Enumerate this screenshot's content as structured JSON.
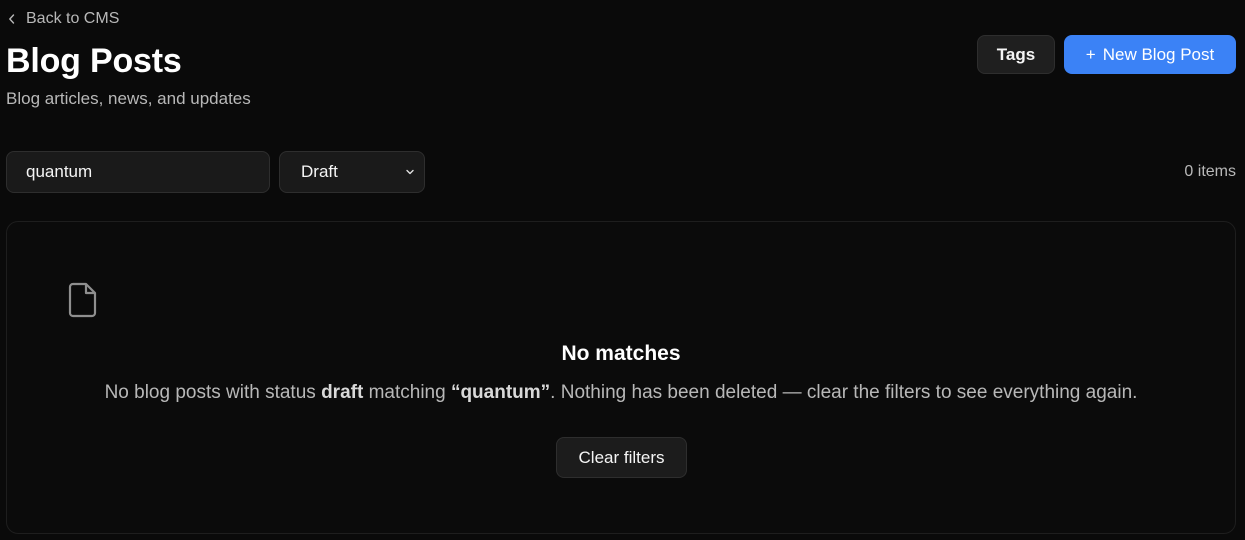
{
  "header": {
    "back_link": "Back to CMS",
    "title": "Blog Posts",
    "subtitle": "Blog articles, news, and updates",
    "tags_button": "Tags",
    "new_button_icon": "+",
    "new_button": "New Blog Post"
  },
  "filters": {
    "search_value": "quantum",
    "status_value": "Draft",
    "item_count": "0 items"
  },
  "empty_state": {
    "icon": "file-icon",
    "title": "No matches",
    "desc_part1": "No blog posts with status ",
    "desc_status": "draft",
    "desc_part2": " matching ",
    "desc_query": "“quantum”",
    "desc_part3": ". Nothing has been deleted — clear the filters to see everything again.",
    "clear_button": "Clear filters"
  },
  "colors": {
    "background": "#0a0a0a",
    "accent": "#3b82f6",
    "muted_text": "#b8b8b8"
  }
}
